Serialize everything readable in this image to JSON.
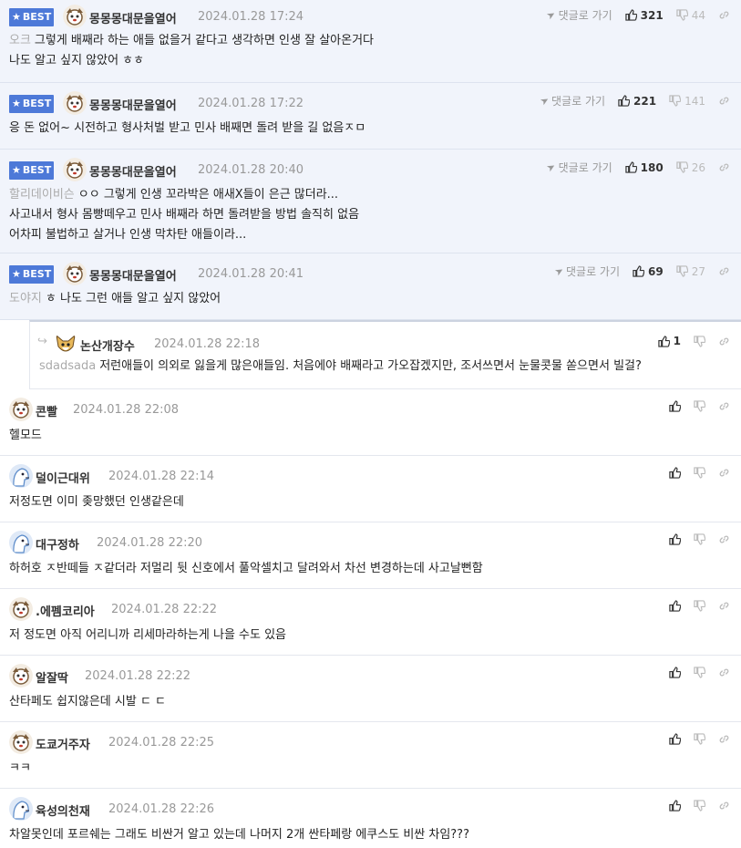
{
  "best_label": "BEST",
  "reply_label": "댓글로 가기",
  "comments": [
    {
      "nick": "몽몽몽대문을열어",
      "date": "2024.01.28 17:24",
      "up": "321",
      "down": "44",
      "mention": "오크",
      "lines": [
        "그렇게 배째라 하는 애들 없을거 같다고 생각하면 인생 잘 살아온거다",
        "나도 알고 싶지 않았어 ㅎㅎ"
      ]
    },
    {
      "nick": "몽몽몽대문을열어",
      "date": "2024.01.28 17:22",
      "up": "221",
      "down": "141",
      "mention": "",
      "lines": [
        "응 돈 없어~ 시전하고 형사처벌 받고 민사 배째면 돌려 받을 길 없음ㅈㅁ"
      ]
    },
    {
      "nick": "몽몽몽대문을열어",
      "date": "2024.01.28 20:40",
      "up": "180",
      "down": "26",
      "mention": "할리데이비슨",
      "lines": [
        "ㅇㅇ 그렇게 인생 꼬라박은 애새X들이 은근 많더라...",
        "사고내서 형사 몸빵떼우고 민사 배째라 하면 돌려받을 방법 솔직히 없음",
        "어차피 불법하고 살거나 인생 막차탄 애들이라..."
      ]
    },
    {
      "nick": "몽몽몽대문을열어",
      "date": "2024.01.28 20:41",
      "up": "69",
      "down": "27",
      "mention": "도야지",
      "lines": [
        "ㅎ 나도 그런 애들 알고 싶지 않았어"
      ]
    },
    {
      "nick": "논산개장수",
      "date": "2024.01.28 22:18",
      "up": "1",
      "mention": "sdadsada",
      "lines": [
        "저런애들이 의외로 잃을게 많은애들임. 처음에야 배째라고 가오잡겠지만, 조서쓰면서 눈물콧물 쏟으면서 빌걸?"
      ]
    },
    {
      "nick": "콘빨",
      "date": "2024.01.28 22:08",
      "lines": [
        "헬모드"
      ]
    },
    {
      "nick": "덜이근대위",
      "date": "2024.01.28 22:14",
      "lines": [
        "저정도면 이미 좆망했던 인생같은데"
      ]
    },
    {
      "nick": "대구정하",
      "date": "2024.01.28 22:20",
      "lines": [
        "하허호 ㅈ반떼들 ㅈ같더라 저멀리 뒷 신호에서 풀악셀치고 달려와서 차선 변경하는데 사고날뻔함"
      ]
    },
    {
      "nick": ".에펨코리아",
      "date": "2024.01.28 22:22",
      "lines": [
        "저 정도면 아직 어리니까 리세마라하는게 나을 수도 있음"
      ]
    },
    {
      "nick": "알잘딱",
      "date": "2024.01.28 22:22",
      "lines": [
        "산타페도 쉽지않은데 시발 ㄷ ㄷ"
      ]
    },
    {
      "nick": "도쿄거주자",
      "date": "2024.01.28 22:25",
      "lines": [
        "ㅋㅋ"
      ]
    },
    {
      "nick": "육성의천재",
      "date": "2024.01.28 22:26",
      "lines": [
        "차알못인데 포르쉐는 그래도 비싼거 알고 있는데 나머지 2개 싼타페랑 에쿠스도 비싼 차임???"
      ]
    }
  ]
}
